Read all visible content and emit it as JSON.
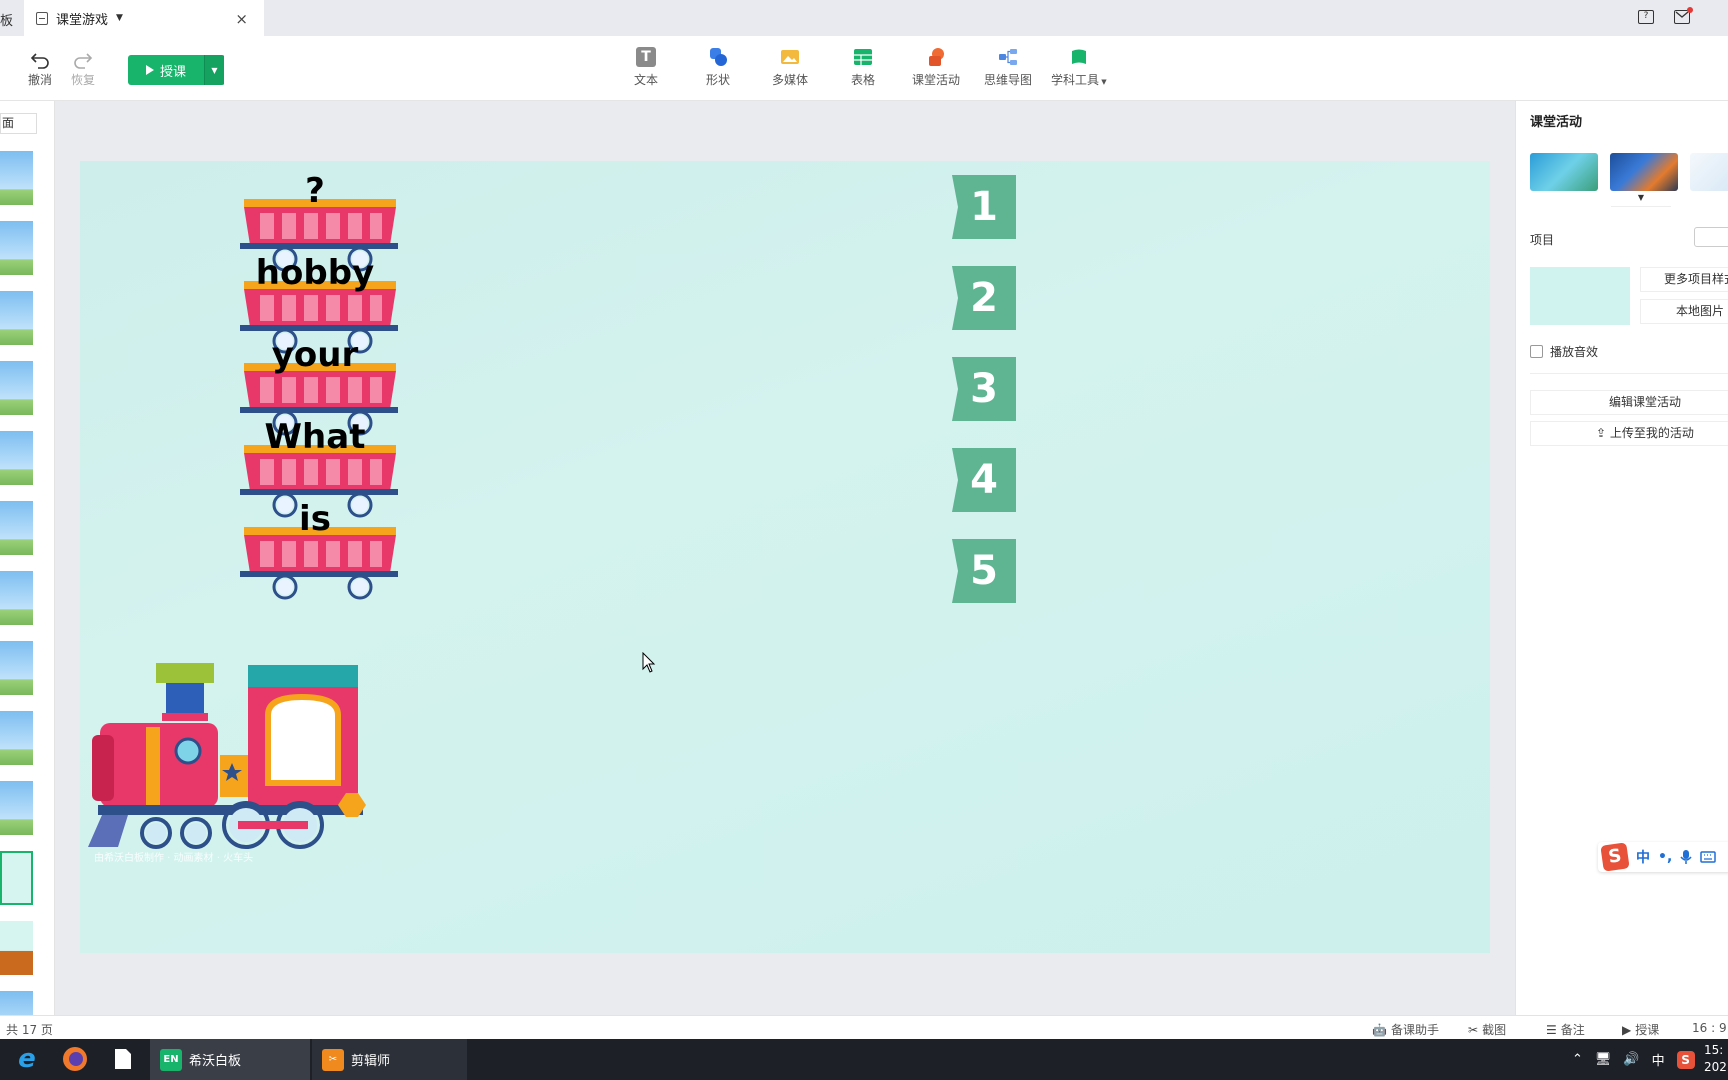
{
  "titlebar": {
    "edge_text": "板",
    "tab_title": "课堂游戏",
    "tab_close": "×"
  },
  "toolbar": {
    "undo_label": "撤消",
    "redo_label": "恢复",
    "teach_label": "授课",
    "insert_items": [
      {
        "label": "文本",
        "icon": "text-icon",
        "color": "#8a8a8a"
      },
      {
        "label": "形状",
        "icon": "shape-icon",
        "color": "#3b7ee8"
      },
      {
        "label": "多媒体",
        "icon": "media-icon",
        "color": "#f3b93e"
      },
      {
        "label": "表格",
        "icon": "table-icon",
        "color": "#18b46b"
      },
      {
        "label": "课堂活动",
        "icon": "activity-icon",
        "color": "#f06a34"
      },
      {
        "label": "思维导图",
        "icon": "mindmap-icon",
        "color": "#4d86e0"
      },
      {
        "label": "学科工具",
        "icon": "subject-tools-icon",
        "color": "#18b46b"
      }
    ]
  },
  "left_panel": {
    "label": "面"
  },
  "slide": {
    "words": [
      "?",
      "hobby",
      "your",
      "What",
      "is"
    ],
    "numbers": [
      "1",
      "2",
      "3",
      "4",
      "5"
    ],
    "caption": "由希沃白板制作 · 动画素材 · 火车头",
    "colors": {
      "background": "#d1f3ef",
      "number_tile": "#5fb592",
      "wagon_body": "#e8386a",
      "wagon_trim": "#f7a41d"
    }
  },
  "right_panel": {
    "title": "课堂活动",
    "item_label": "项目",
    "more_styles": "更多项目样式",
    "local_image": "本地图片",
    "play_sound": "播放音效",
    "edit_activity": "编辑课堂活动",
    "upload_activity": "上传至我的活动"
  },
  "ime": {
    "lang": "中",
    "punct": "•,"
  },
  "statusbar": {
    "pages": "共 17 页",
    "assistant": "备课助手",
    "screenshot": "截图",
    "notes": "备注",
    "teach": "授课",
    "ratio": "16 : 9"
  },
  "taskbar": {
    "app1": "希沃白板",
    "app2": "剪辑师",
    "tray_lang": "中",
    "clock_time": "15:",
    "clock_date": "202"
  }
}
